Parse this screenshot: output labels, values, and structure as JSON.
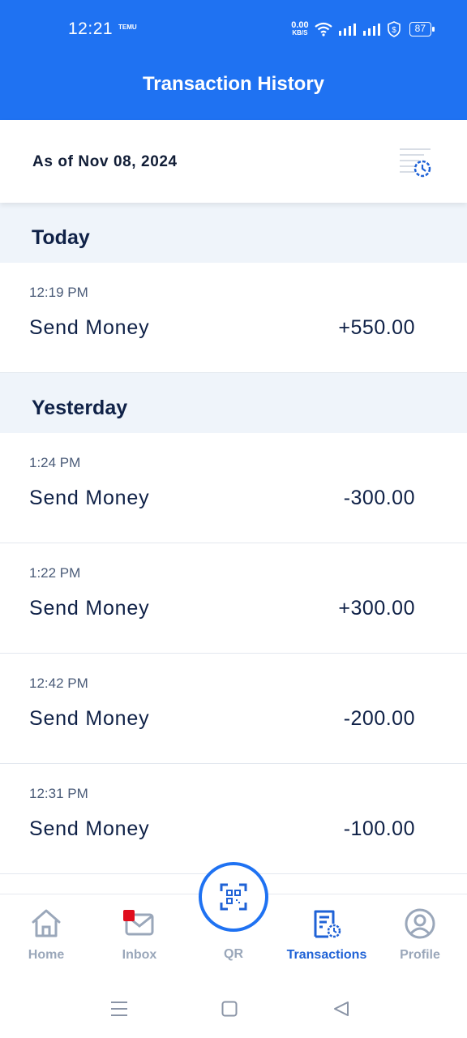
{
  "status_bar": {
    "time": "12:21",
    "notification_app": "TEMU",
    "network_speed_value": "0.00",
    "network_speed_unit": "KB/S",
    "battery": "87"
  },
  "header": {
    "title": "Transaction History"
  },
  "as_of": {
    "text": "As of Nov 08, 2024"
  },
  "sections": [
    {
      "label": "Today",
      "transactions": [
        {
          "time": "12:19 PM",
          "name": "Send Money",
          "amount": "+550.00"
        }
      ]
    },
    {
      "label": "Yesterday",
      "transactions": [
        {
          "time": "1:24 PM",
          "name": "Send Money",
          "amount": "-300.00"
        },
        {
          "time": "1:22 PM",
          "name": "Send Money",
          "amount": "+300.00"
        },
        {
          "time": "12:42 PM",
          "name": "Send Money",
          "amount": "-200.00"
        },
        {
          "time": "12:31 PM",
          "name": "Send Money",
          "amount": "-100.00"
        }
      ]
    }
  ],
  "bottom_nav": {
    "home": "Home",
    "inbox": "Inbox",
    "qr": "QR",
    "transactions": "Transactions",
    "profile": "Profile",
    "active": "transactions"
  },
  "colors": {
    "brand_blue": "#1f72f2",
    "active_nav": "#1f62d6",
    "inactive_nav": "#9aa7ba",
    "badge_red": "#e00d1d"
  }
}
